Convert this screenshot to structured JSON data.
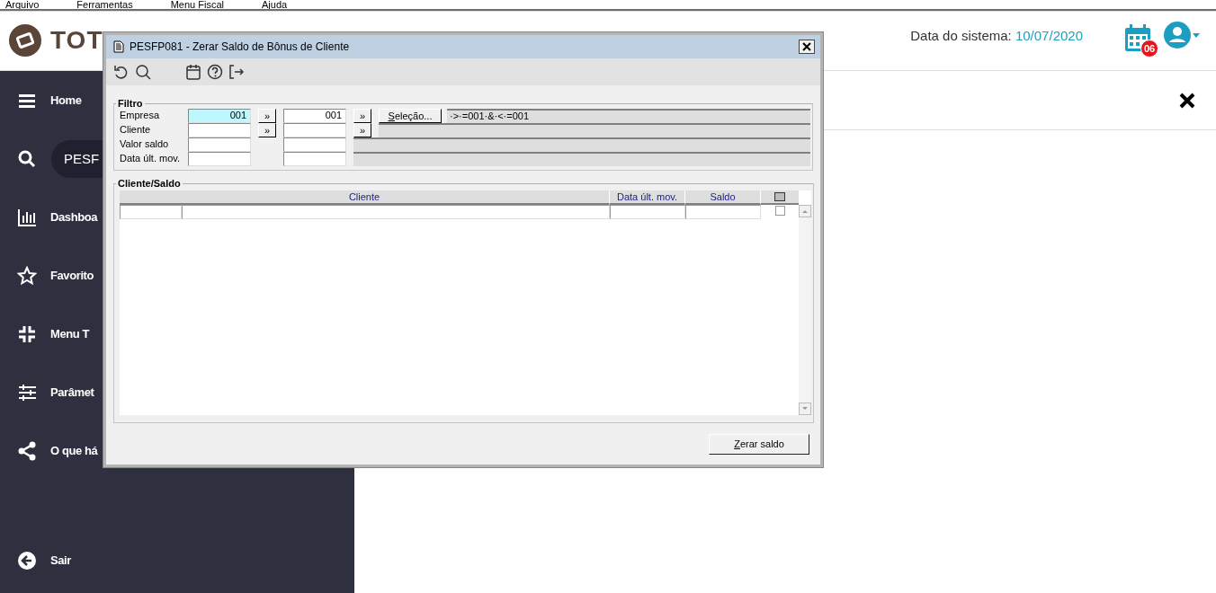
{
  "menu_bar": [
    "Arquivo",
    "Ferramentas",
    "Menu Fiscal",
    "Ajuda"
  ],
  "header": {
    "logo_text": "TOT",
    "date_label": "Data do sistema:",
    "date_value": "10/07/2020",
    "notification_count": "06"
  },
  "sidebar": {
    "items": [
      {
        "kind": "link",
        "label": "Home"
      },
      {
        "kind": "search",
        "label": "PESF"
      },
      {
        "kind": "link",
        "label": "Dashboa"
      },
      {
        "kind": "link",
        "label": "Favorito"
      },
      {
        "kind": "link",
        "label": "Menu T"
      },
      {
        "kind": "link",
        "label": "Parâmet"
      },
      {
        "kind": "link",
        "label": "O que há"
      },
      {
        "kind": "bottom",
        "label": "Sair"
      }
    ]
  },
  "dialog": {
    "title": "PESFP081 - Zerar Saldo de Bônus de Cliente",
    "filter": {
      "title": "Filtro",
      "selection_button": "Seleção...",
      "range_button": "»",
      "rows": [
        {
          "kind": "range",
          "label": "Empresa",
          "from": "001",
          "to": "001",
          "focused": true,
          "expression": "·>·=001·&·<·=001"
        },
        {
          "kind": "range",
          "label": "Cliente",
          "focused": false
        },
        {
          "kind": "plain",
          "label": "Valor saldo",
          "focused": false
        },
        {
          "kind": "plain",
          "label": "Data últ. mov.",
          "focused": false
        }
      ]
    },
    "grid": {
      "title": "Cliente/Saldo",
      "columns": [
        "Cliente",
        "Data últ. mov.",
        "Saldo"
      ],
      "rows": [
        {
          "checked": false
        }
      ]
    },
    "action_button": "Zerar saldo"
  }
}
